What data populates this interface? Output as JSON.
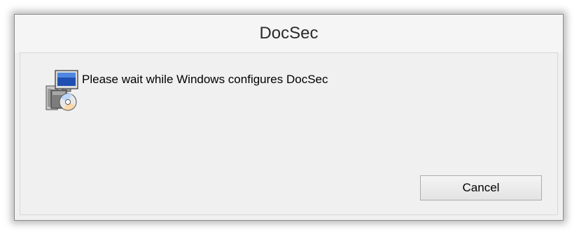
{
  "window": {
    "title": "DocSec"
  },
  "dialog": {
    "message": "Please wait while Windows configures DocSec",
    "icon": "installer-package-icon",
    "cancel_label": "Cancel"
  }
}
